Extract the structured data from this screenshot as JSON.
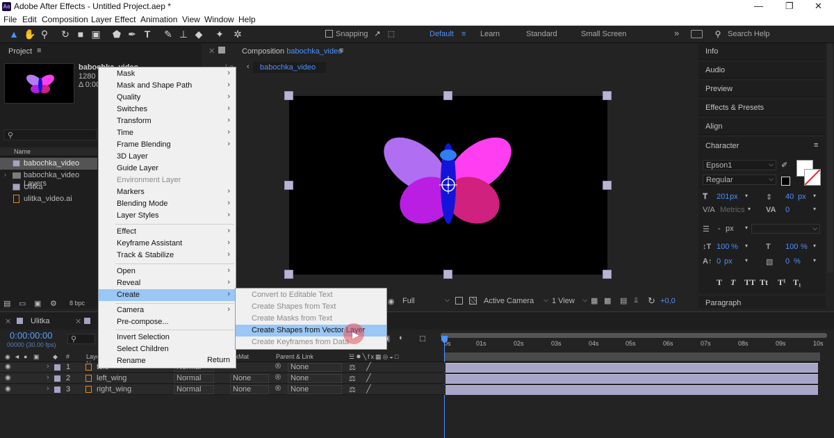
{
  "app": {
    "title": "Adobe After Effects - Untitled Project.aep *",
    "logo": "Ae",
    "minimize": "—",
    "maximize": "❐",
    "close": "✕"
  },
  "menu": [
    "File",
    "Edit",
    "Composition",
    "Layer",
    "Effect",
    "Animation",
    "View",
    "Window",
    "Help"
  ],
  "toolbar": {
    "snapping": "Snapping",
    "workspaces": [
      "Default",
      "Learn",
      "Standard",
      "Small Screen"
    ],
    "search_placeholder": "Search Help",
    "more": "»"
  },
  "project": {
    "title": "Project",
    "selected_name": "babochka_video",
    "selected_info": "1280 x",
    "selected_duration": "Δ 0:00:",
    "column_name": "Name",
    "items": [
      {
        "name": "babochka_video",
        "type": "comp"
      },
      {
        "name": "babochka_video Layers",
        "type": "folder"
      },
      {
        "name": "Ulitka",
        "type": "comp"
      },
      {
        "name": "ulitka_video.ai",
        "type": "ai"
      }
    ],
    "bpc": "8 bpc"
  },
  "composition": {
    "tab_label": "Composition",
    "name": "babochka_video",
    "breadcrumb": "babochka_video",
    "quality": "Full",
    "camera": "Active Camera",
    "view": "1 View",
    "exposure": "+0,0",
    "flow_prefix": "La"
  },
  "right_panels": [
    "Info",
    "Audio",
    "Preview",
    "Effects & Presets",
    "Align"
  ],
  "character": {
    "title": "Character",
    "font": "Epson1",
    "style": "Regular",
    "size": "201",
    "size_unit": "px",
    "leading": "40",
    "leading_unit": "px",
    "kerning": "Metrics",
    "tracking": "0",
    "stroke_width": "-",
    "stroke_unit": "px",
    "vscale": "100",
    "hscale": "100",
    "pct": "%",
    "baseline": "0",
    "baseline_unit": "px",
    "tsume": "0",
    "styles": [
      "T",
      "T",
      "TT",
      "Tt",
      "T¹",
      "T₁"
    ]
  },
  "paragraph": {
    "title": "Paragraph"
  },
  "context_menu": {
    "items": [
      {
        "label": "Mask",
        "sub": true
      },
      {
        "label": "Mask and Shape Path",
        "sub": true
      },
      {
        "label": "Quality",
        "sub": true
      },
      {
        "label": "Switches",
        "sub": true
      },
      {
        "label": "Transform",
        "sub": true
      },
      {
        "label": "Time",
        "sub": true
      },
      {
        "label": "Frame Blending",
        "sub": true
      },
      {
        "label": "3D Layer",
        "sub": false
      },
      {
        "label": "Guide Layer",
        "sub": false
      },
      {
        "label": "Environment Layer",
        "sub": false,
        "disabled": true
      },
      {
        "label": "Markers",
        "sub": true
      },
      {
        "label": "Blending Mode",
        "sub": true
      },
      {
        "label": "Layer Styles",
        "sub": true
      },
      {
        "label": "Effect",
        "sub": true
      },
      {
        "label": "Keyframe Assistant",
        "sub": true
      },
      {
        "label": "Track & Stabilize",
        "sub": true
      },
      {
        "label": "Open",
        "sub": true
      },
      {
        "label": "Reveal",
        "sub": true
      },
      {
        "label": "Create",
        "sub": true,
        "highlight": true
      },
      {
        "label": "Camera",
        "sub": true
      },
      {
        "label": "Pre-compose...",
        "sub": false
      },
      {
        "label": "Invert Selection",
        "sub": false
      },
      {
        "label": "Select Children",
        "sub": false
      },
      {
        "label": "Rename",
        "sub": false,
        "shortcut": "Return"
      }
    ]
  },
  "submenu": {
    "items": [
      {
        "label": "Convert to Editable Text",
        "disabled": true
      },
      {
        "label": "Create Shapes from Text",
        "disabled": true
      },
      {
        "label": "Create Masks from Text",
        "disabled": true
      },
      {
        "label": "Create Shapes from Vector Layer",
        "highlight": true
      },
      {
        "label": "Create Keyframes from Data",
        "disabled": true
      }
    ]
  },
  "timeline": {
    "tabs": [
      "Ulitka",
      "babochka_video"
    ],
    "timecode": "0:00:00:00",
    "frames": "00000 (30.00 fps)",
    "columns": {
      "layer": "Layer Name",
      "trkmat": "TrkMat",
      "parent": "Parent & Link",
      "num": "#"
    },
    "ruler": [
      "0s",
      "01s",
      "02s",
      "03s",
      "04s",
      "05s",
      "06s",
      "07s",
      "08s",
      "09s",
      "10s"
    ],
    "layers": [
      {
        "num": "1",
        "name": "telo",
        "mode": "Normal",
        "trkmat": "",
        "parent": "None"
      },
      {
        "num": "2",
        "name": "left_wing",
        "mode": "Normal",
        "trkmat": "None",
        "parent": "None"
      },
      {
        "num": "3",
        "name": "right_wing",
        "mode": "Normal",
        "trkmat": "None",
        "parent": "None"
      }
    ]
  },
  "colors": {
    "accent": "#4d90ff",
    "menu_highlight": "#9ac7f5",
    "track_bar": "#a8a6c8",
    "timecode": "#5aa0ff"
  }
}
